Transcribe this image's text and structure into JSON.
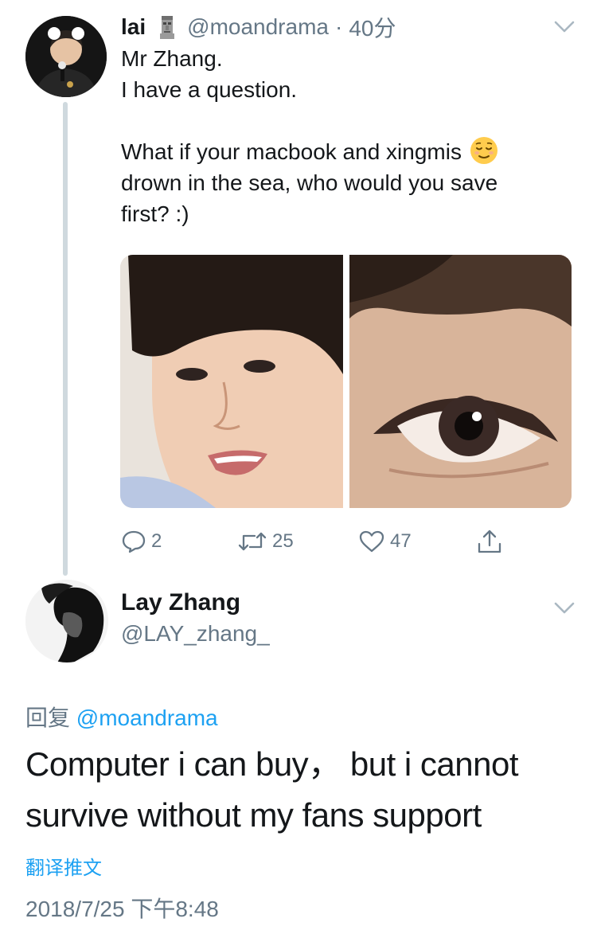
{
  "tweet": {
    "author_name": "lai",
    "author_handle": "@moandrama",
    "separator": "·",
    "time_ago": "40分",
    "lines": [
      "Mr Zhang.",
      "I have a question.",
      "",
      "What if your macbook and xingmis",
      "drown in the sea, who would you save",
      "first? :)"
    ],
    "emoji": "relieved-face-emoji",
    "actions": {
      "reply_count": "2",
      "retweet_count": "25",
      "like_count": "47"
    }
  },
  "reply": {
    "author_name": "Lay Zhang",
    "author_handle": "@LAY_zhang_",
    "reply_prefix": "回复",
    "reply_mention": "@moandrama",
    "text_line1": "Computer i can buy， but i cannot",
    "text_line2": "survive without my fans support",
    "translate_label": "翻译推文",
    "timestamp": "2018/7/25 下午8:48"
  },
  "icons": {
    "reply": "comment-icon",
    "retweet": "retweet-icon",
    "like": "heart-icon",
    "share": "share-icon",
    "menu": "chevron-down-icon"
  },
  "colors": {
    "text": "#14171a",
    "secondary": "#657786",
    "link": "#1da1f2",
    "thread_line": "#cfd9de"
  }
}
